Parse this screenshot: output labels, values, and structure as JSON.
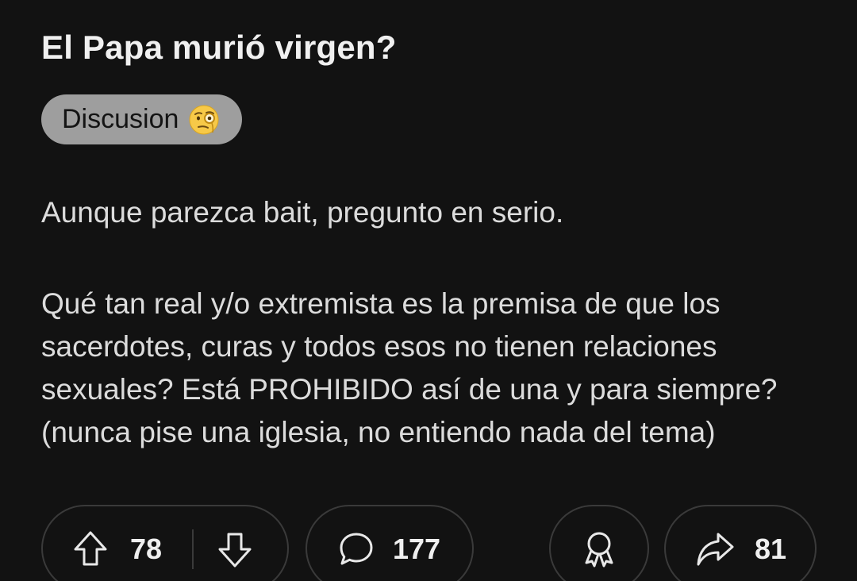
{
  "post": {
    "title": "El Papa murió virgen?",
    "flair": {
      "label": "Discusion",
      "emoji_icon": "face-with-monocle-icon"
    },
    "body": [
      "Aunque parezca bait, pregunto en serio.",
      "Qué tan real y/o extremista es la premisa de que los sacerdotes, curas y todos esos no tienen relaciones sexuales? Está PROHIBIDO así de una y para siempre? (nunca pise una iglesia, no entiendo nada del tema)"
    ]
  },
  "actions": {
    "upvotes": "78",
    "comments": "177",
    "shares": "81",
    "icons": {
      "upvote": "arrow-up-icon",
      "downvote": "arrow-down-icon",
      "comment": "speech-bubble-icon",
      "award": "award-ribbon-icon",
      "share": "share-arrow-icon"
    }
  },
  "colors": {
    "background": "#121212",
    "flair_bg": "#9e9e9e",
    "pill_border": "#3a3a3a",
    "text": "#e8e8e8"
  }
}
